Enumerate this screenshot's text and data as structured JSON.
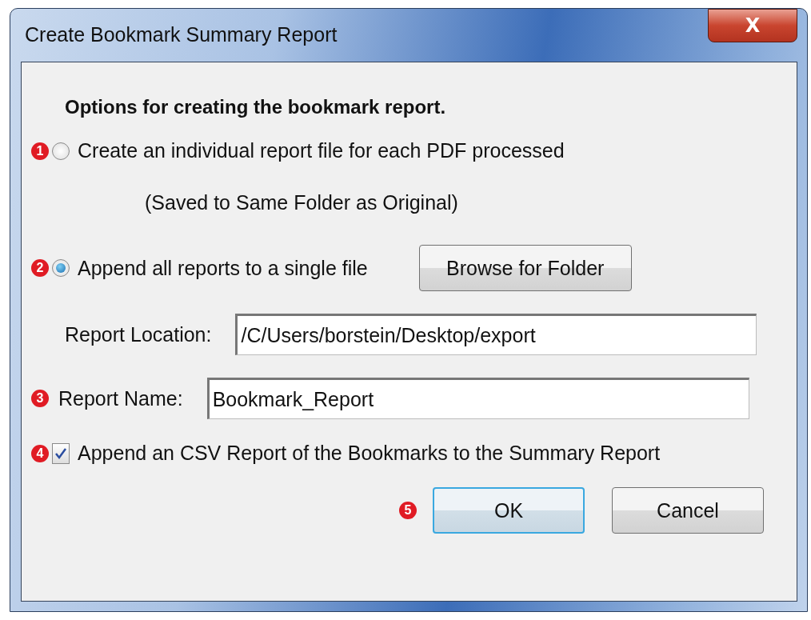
{
  "window": {
    "title": "Create Bookmark Summary Report",
    "close": "X"
  },
  "heading": "Options for creating the bookmark report.",
  "options": [
    {
      "badge": "1",
      "label": "Create an individual report file for each PDF processed",
      "selected": false,
      "note": "(Saved to Same Folder as Original)"
    },
    {
      "badge": "2",
      "label": "Append all reports to a single file",
      "selected": true,
      "button": "Browse for Folder"
    }
  ],
  "location": {
    "label": "Report Location:",
    "value": "/C/Users/borstein/Desktop/export"
  },
  "name": {
    "badge": "3",
    "label": "Report Name:",
    "value": "Bookmark_Report"
  },
  "csv": {
    "badge": "4",
    "label": "Append an CSV Report of the Bookmarks to the Summary Report",
    "checked": true
  },
  "buttons": [
    {
      "label": "OK",
      "badge": "5",
      "default": true
    },
    {
      "label": "Cancel",
      "default": false
    }
  ]
}
